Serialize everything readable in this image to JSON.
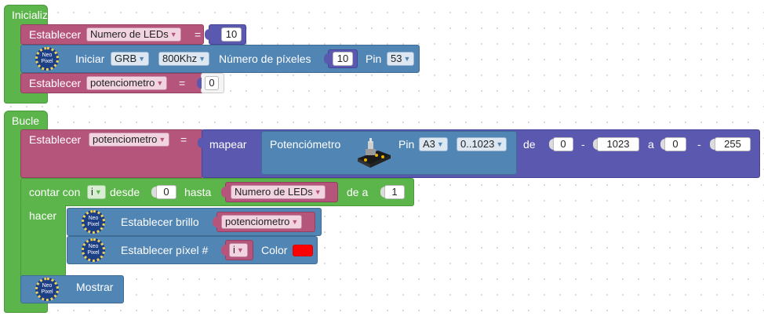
{
  "init": {
    "hat_label": "Inicializar",
    "set_leds": {
      "label": "Establecer",
      "var": "Numero de LEDs",
      "eq": "=",
      "value": "10"
    },
    "start": {
      "label": "Iniciar",
      "mode": "GRB",
      "freq": "800Khz",
      "pixels_label": "Número de píxeles",
      "pixels": "10",
      "pin_label": "Pin",
      "pin": "53"
    },
    "set_pot": {
      "label": "Establecer",
      "var": "potenciometro",
      "eq": "=",
      "value": "0"
    }
  },
  "loop": {
    "hat_label": "Bucle",
    "set_pot": {
      "label": "Establecer",
      "var": "potenciometro",
      "eq": "="
    },
    "map": {
      "label": "mapear",
      "sensor_label": "Potenciómetro",
      "pin_label": "Pin",
      "pin": "A3",
      "range": "0..1023",
      "from_label": "de",
      "from_low": "0",
      "dash1": "-",
      "from_high": "1023",
      "to_label": "a",
      "to_low": "0",
      "dash2": "-",
      "to_high": "255"
    },
    "count": {
      "label": "contar con",
      "var": "i",
      "from_label": "desde",
      "from": "0",
      "to_label": "hasta",
      "to_var": "Numero de LEDs",
      "step_label": "de a",
      "step": "1"
    },
    "do_label": "hacer",
    "brightness": {
      "label": "Establecer brillo",
      "var": "potenciometro"
    },
    "pixel": {
      "label": "Establecer píxel #",
      "var": "i",
      "color_label": "Color",
      "color": "#ff0000"
    },
    "show": {
      "label": "Mostrar"
    }
  },
  "neopixel_icon_text": [
    "Neo",
    "Pixel"
  ],
  "colors": {
    "control": "#5cb54b",
    "variable": "#b6557c",
    "neopixel": "#5185b3",
    "math": "#5b58b0",
    "background": "#ffffff"
  }
}
